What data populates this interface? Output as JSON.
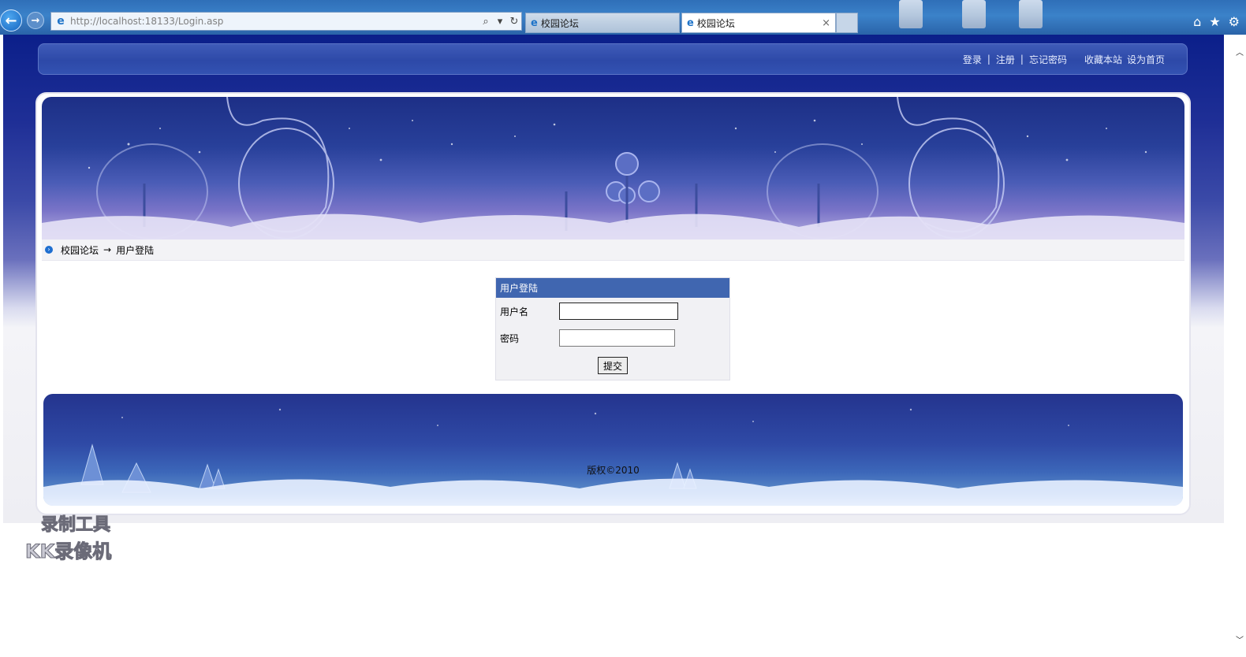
{
  "browser": {
    "url_host": "http://localhost",
    "url_rest": ":18133/Login.asp",
    "tabs": [
      {
        "title": "校园论坛",
        "active": false
      },
      {
        "title": "校园论坛",
        "active": true
      }
    ],
    "tab_close": "×",
    "back_glyph": "←",
    "forward_glyph": "→",
    "search_glyph": "⌕",
    "refresh_glyph": "↻",
    "home_glyph": "⌂",
    "favorites_glyph": "★",
    "settings_glyph": "⚙"
  },
  "topbar": {
    "links": [
      "登录",
      "注册",
      "忘记密码"
    ],
    "separator": "|",
    "extra_links": [
      "收藏本站",
      "设为首页"
    ]
  },
  "breadcrumb": {
    "home": "校园论坛",
    "arrow": "→",
    "current": "用户登陆"
  },
  "login": {
    "title": "用户登陆",
    "username_label": "用户名",
    "username_value": "",
    "password_label": "密码",
    "password_value": "",
    "submit_label": "提交"
  },
  "footer": {
    "copyright": "版权©2010"
  },
  "watermark": {
    "line1": "录制工具",
    "line2": "KK录像机"
  },
  "colors": {
    "login_header": "#4066b0",
    "topbar": "#2d49a8",
    "page_top": "#0b1f8a"
  }
}
